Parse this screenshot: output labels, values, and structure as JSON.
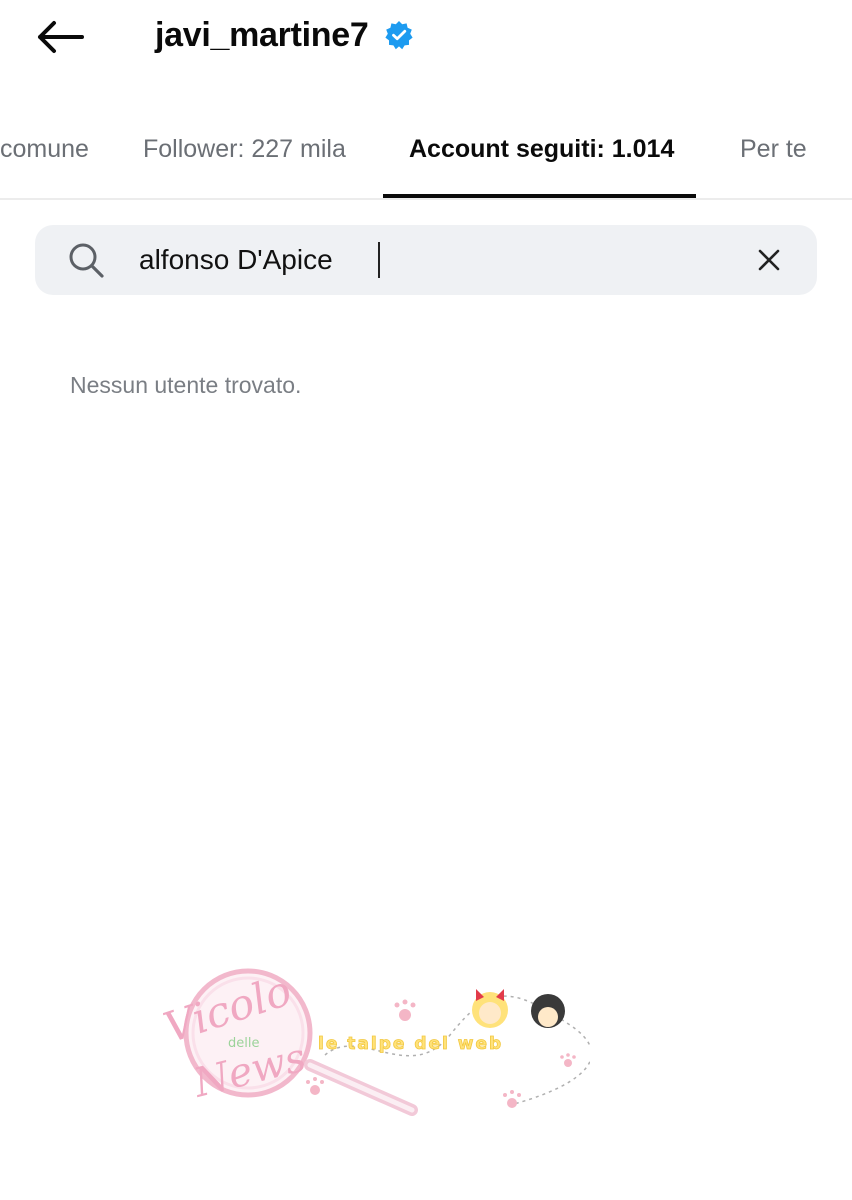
{
  "header": {
    "username": "javi_martine7",
    "back_icon": "arrow-left-icon",
    "verified_icon": "verified-badge-icon",
    "verified_color": "#1d9bf0"
  },
  "tabs": [
    {
      "label": "comune",
      "active": false
    },
    {
      "label": "Follower: 227 mila",
      "active": false
    },
    {
      "label": "Account seguiti: 1.014",
      "active": true
    },
    {
      "label": "Per te",
      "active": false
    }
  ],
  "search": {
    "value": "alfonso D'Apice",
    "search_icon": "search-icon",
    "clear_icon": "close-icon"
  },
  "results": {
    "empty_message": "Nessun utente trovato."
  },
  "watermark": {
    "line1": "Vicolo",
    "line2": "delle",
    "line3": "News",
    "tagline": "le talpe del web"
  }
}
